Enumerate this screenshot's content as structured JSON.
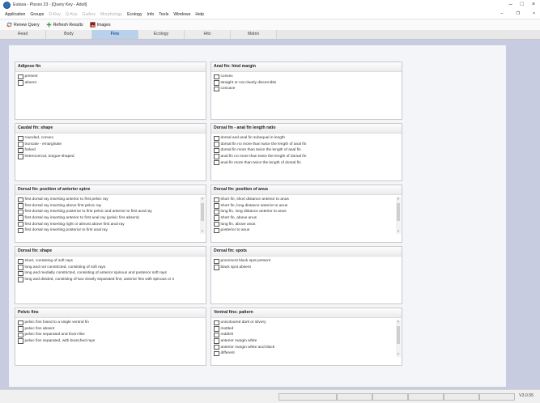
{
  "window": {
    "title": "Eutaxa - Pisces 23 - [Query Key - Adult]",
    "controls": [
      "–",
      "□",
      "×"
    ]
  },
  "menu": {
    "items": [
      {
        "label": "Application",
        "enabled": true
      },
      {
        "label": "Groups",
        "enabled": true
      },
      {
        "label": "D-Key",
        "enabled": false
      },
      {
        "label": "Q-Key",
        "enabled": false
      },
      {
        "label": "Gallery",
        "enabled": false
      },
      {
        "label": "Morphology",
        "enabled": false
      },
      {
        "label": "Ecology",
        "enabled": true
      },
      {
        "label": "Info",
        "enabled": true
      },
      {
        "label": "Tools",
        "enabled": true
      },
      {
        "label": "Windows",
        "enabled": true
      },
      {
        "label": "Help",
        "enabled": true
      }
    ],
    "mdi_controls": [
      "–",
      "❐",
      "×"
    ]
  },
  "toolbar": {
    "renew_label": "Renew Query",
    "refresh_label": "Refresh Results",
    "images_label": "Images"
  },
  "tabs": [
    {
      "label": "Head",
      "active": false
    },
    {
      "label": "Body",
      "active": false
    },
    {
      "label": "Fins",
      "active": true
    },
    {
      "label": "Ecology",
      "active": false
    },
    {
      "label": "Hits",
      "active": false
    },
    {
      "label": "Matrix",
      "active": false
    }
  ],
  "cards": [
    {
      "title": "Adipose fin",
      "scroll": false,
      "options": [
        "present",
        "absent"
      ]
    },
    {
      "title": "Anal fin: hind margin",
      "scroll": false,
      "options": [
        "convex",
        "straight or not clearly discernible",
        "concave"
      ]
    },
    {
      "title": "Caudal fin: shape",
      "scroll": false,
      "options": [
        "rounded, convex",
        "truncate - emarginate",
        "forked",
        "heterocercal, tongue-shaped"
      ]
    },
    {
      "title": "Dorsal fin - anal fin length ratio",
      "scroll": false,
      "options": [
        "dorsal and anal fin subequal in length",
        "dorsal fin no more than twice the length of anal fin",
        "dorsal fin more than twice the length of anal fin",
        "anal fin no more than twice the length of dorsal fin",
        "anal fin more than twice the length of dorsal fin"
      ]
    },
    {
      "title": "Dorsal fin: position of anterior spine",
      "scroll": true,
      "options": [
        "first dorsal ray inserting anterior to first pelvic ray",
        "first dorsal ray inserting above first pelvic ray",
        "first dorsal ray inserting posterior to first pelvic and anterior to first anal ray",
        "first dorsal ray inserting anterior to first anal ray (pelvic fins absent)",
        "first dorsal ray inserting right or almost above first anal ray",
        "first dorsal ray inserting posterior to first anal ray"
      ]
    },
    {
      "title": "Dorsal fin: position of anus",
      "scroll": true,
      "options": [
        "short fin, short distance anterior to anus",
        "short fin, long distance anterior to anus",
        "long fin, long distance anterior to anus",
        "short fin, above anus",
        "long fin, above anus",
        "posterior to anus"
      ]
    },
    {
      "title": "Dorsal fin: shape",
      "scroll": false,
      "options": [
        "short, consisting of soft rays",
        "long and not constricted, consisting of soft rays",
        "long and medially constricted, consisting of anterior spinous and posterior soft rays",
        "long and divided, consisting of two clearly separated fins; anterior fins with spinous or s"
      ]
    },
    {
      "title": "Dorsal fin: spots",
      "scroll": false,
      "options": [
        "prominent black spot present",
        "black spot absent"
      ]
    },
    {
      "title": "Pelvic fins",
      "scroll": false,
      "options": [
        "pelvic fins fused to a single ventral fin",
        "pelvic fins absent",
        "pelvic fins separated and thorn-like",
        "pelvic fins separated, with branched rays"
      ]
    },
    {
      "title": "Ventral fins: pattern",
      "scroll": true,
      "options": [
        "unicoloured dark or silvery",
        "mottled",
        "reddish",
        "anterior margin white",
        "anterior margin white and black",
        "different"
      ]
    }
  ],
  "status": {
    "version": "V3.0.55"
  },
  "colors": {
    "active_tab_bg": "#b9d1ec",
    "workspace_bg": "#c8cce0",
    "accent": "#2f6fb5"
  }
}
